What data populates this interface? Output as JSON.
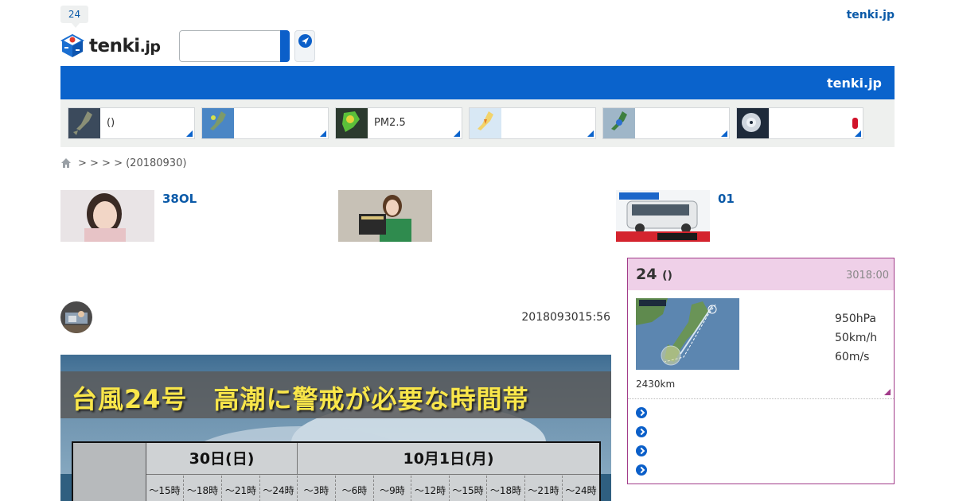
{
  "header": {
    "badge": "24",
    "site_link": "tenki.jp",
    "logo": {
      "main": "tenki",
      "suffix": ".jp"
    }
  },
  "search": {
    "placeholder": "",
    "value": ""
  },
  "navbar": {
    "link": "tenki.jp"
  },
  "map_cards": [
    {
      "label": "()",
      "icon": "japan-weather-map-thumb"
    },
    {
      "label": "",
      "icon": "radar-map-thumb"
    },
    {
      "label": "PM2.5",
      "icon": "pm25-map-thumb"
    },
    {
      "label": "",
      "icon": "warning-map-thumb"
    },
    {
      "label": "",
      "icon": "rain-map-thumb"
    },
    {
      "label": "",
      "icon": "typhoon-satellite-thumb",
      "alert": true
    }
  ],
  "breadcrumb": {
    "text": "> > > > (20180930)"
  },
  "promos": [
    {
      "title": "38OL"
    },
    {
      "title": ""
    },
    {
      "title": "01"
    }
  ],
  "article": {
    "date": "2018093015:56",
    "hero": {
      "title": "台風24号　高潮に警戒が必要な時間帯",
      "days": [
        "30日(日)",
        "10月1日(月)"
      ],
      "slots": [
        "～15時",
        "～18時",
        "～21時",
        "～24時",
        "～3時",
        "～6時",
        "～9時",
        "～12時",
        "～15時",
        "～18時",
        "～21時",
        "～24時"
      ]
    }
  },
  "typhoon_widget": {
    "title": "24",
    "title_suffix": "()",
    "time": "3018:00",
    "pressure": "950hPa",
    "speed": "50km/h",
    "max_wind": "60m/s",
    "distance": "2430km",
    "accent": "#a23c8a"
  },
  "colors": {
    "brand_blue": "#0a63cc",
    "link_blue": "#0b5aa8",
    "widget_head": "#efd0e8"
  }
}
